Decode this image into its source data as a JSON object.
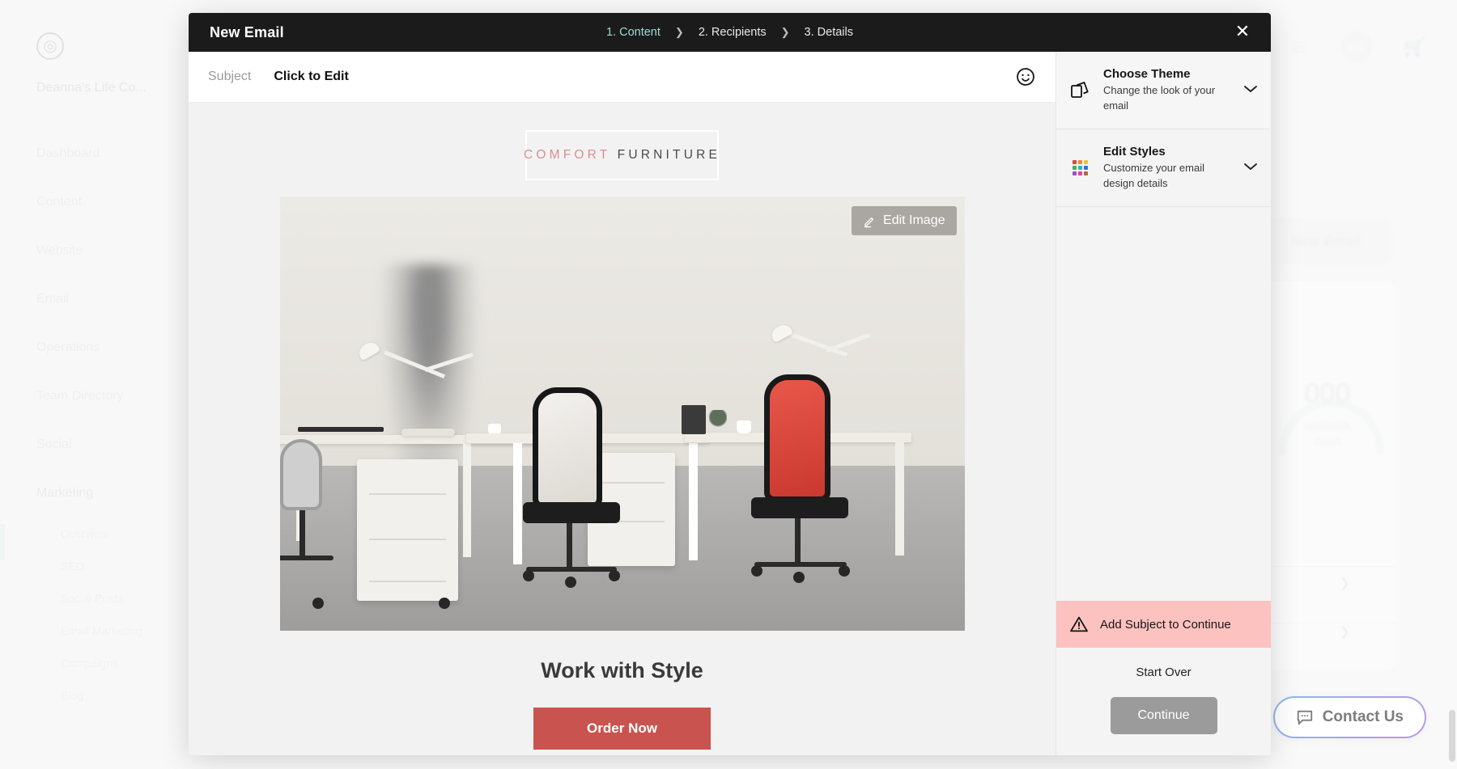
{
  "background": {
    "logo_glyph": "◎",
    "account_name": "Deanna's Life Co...",
    "nav": [
      {
        "label": "Dashboard"
      },
      {
        "label": "Content"
      },
      {
        "label": "Website"
      },
      {
        "label": "Email"
      },
      {
        "label": "Operations"
      },
      {
        "label": "Team Directory"
      },
      {
        "label": "Social"
      },
      {
        "label": "Marketing"
      }
    ],
    "marketing_subitems": [
      {
        "label": "Overview"
      },
      {
        "label": "SEO"
      },
      {
        "label": "Social Posts"
      },
      {
        "label": "Email Marketing"
      },
      {
        "label": "Campaigns"
      },
      {
        "label": "Blog"
      }
    ],
    "topbar": {
      "grid_icon": "⊞",
      "avatar_initials": "DC",
      "cart_icon": "🛒"
    },
    "new_email_button": "New Email",
    "gauge_value": "000",
    "gauge_label_line1": "recipients",
    "gauge_label_line2": "count",
    "contact_us": "Contact Us",
    "contact_icon": "speech-bubble-icon"
  },
  "modal": {
    "title": "New Email",
    "close_icon": "✕",
    "steps": [
      {
        "label": "1. Content",
        "active": true
      },
      {
        "label": "2. Recipients",
        "active": false
      },
      {
        "label": "3. Details",
        "active": false
      }
    ],
    "step_separator": "❯"
  },
  "subject": {
    "label": "Subject",
    "value": "Click to Edit",
    "emoji_icon": "emoji-smiley-icon"
  },
  "email": {
    "logo_primary": "COMFORT",
    "logo_secondary": "FURNITURE",
    "edit_image_label": "Edit Image",
    "edit_image_icon": "pencil-icon",
    "headline": "Work with Style",
    "cta_label": "Order Now"
  },
  "panel": {
    "rows": [
      {
        "title": "Choose Theme",
        "subtitle": "Change the look of your email",
        "icon": "theme-cards-icon",
        "chevron": "⌄"
      },
      {
        "title": "Edit Styles",
        "subtitle": "Customize your email design details",
        "icon": "color-grid-icon",
        "chevron": "⌄"
      }
    ],
    "alert": {
      "text": "Add Subject to Continue",
      "icon": "warning-triangle-icon"
    },
    "start_over_label": "Start Over",
    "continue_label": "Continue"
  },
  "colors": {
    "header_bg": "#1b1b1b",
    "step_active": "#9fdcd4",
    "cta_red": "#c9534f",
    "logo_rose": "#d98f8f",
    "alert_pink": "#fcc2c0",
    "continue_gray": "#9b9b9b",
    "grid_icon_colors": [
      "#e0443b",
      "#f08a2c",
      "#f2c52b",
      "#4caf50",
      "#2bb5c4",
      "#3b6fd4",
      "#8e56c9",
      "#e0449c",
      "#a3703f"
    ]
  }
}
